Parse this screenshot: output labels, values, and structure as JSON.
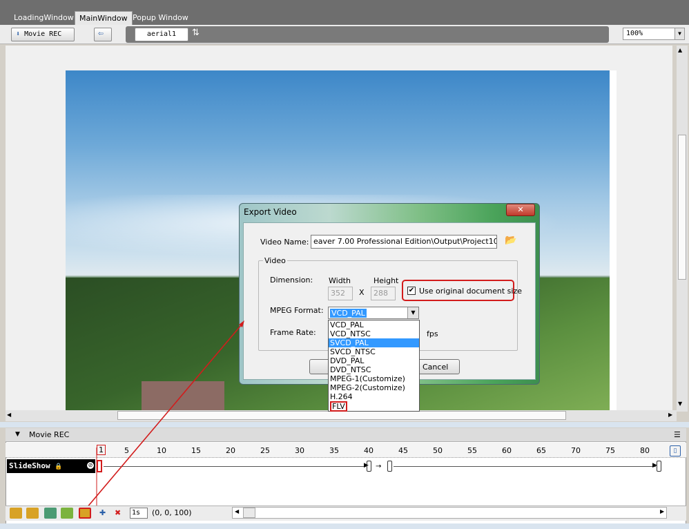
{
  "tabs": [
    {
      "label": "LoadingWindow",
      "active": false
    },
    {
      "label": "MainWindow",
      "active": true
    },
    {
      "label": "Popup Window",
      "active": false
    }
  ],
  "toolbar": {
    "movie_rec_label": "Movie REC",
    "layer_input": "aerial1",
    "zoom_value": "100%"
  },
  "dialog": {
    "title": "Export Video",
    "close_label": "✕",
    "video_name_label": "Video Name:",
    "video_name_value": "eaver 7.00 Professional Edition\\Output\\Project10.mpg",
    "group_label": "Video",
    "dimension_label": "Dimension:",
    "width_label": "Width",
    "height_label": "Height",
    "width_value": "352",
    "height_value": "288",
    "x_label": "X",
    "use_original_label": "Use original document size",
    "use_original_checked": true,
    "mpeg_format_label": "MPEG Format:",
    "mpeg_format_value": "VCD_PAL",
    "frame_rate_label": "Frame Rate:",
    "fps_label": "fps",
    "cancel_label": "Cancel",
    "format_options": [
      {
        "label": "VCD_PAL",
        "selected": false
      },
      {
        "label": "VCD_NTSC",
        "selected": false
      },
      {
        "label": "SVCD_PAL",
        "selected": true
      },
      {
        "label": "SVCD_NTSC",
        "selected": false
      },
      {
        "label": "DVD_PAL",
        "selected": false
      },
      {
        "label": "DVD_NTSC",
        "selected": false
      },
      {
        "label": "MPEG-1(Customize)",
        "selected": false
      },
      {
        "label": "MPEG-2(Customize)",
        "selected": false
      },
      {
        "label": "H.264",
        "selected": false
      },
      {
        "label": "FLV",
        "selected": false
      }
    ]
  },
  "timeline": {
    "panel_title": "Movie REC",
    "ruler_ticks": [
      "1",
      "5",
      "10",
      "15",
      "20",
      "25",
      "30",
      "35",
      "40",
      "45",
      "50",
      "55",
      "60",
      "65",
      "70",
      "75",
      "80"
    ],
    "layer_name": "SlideShow",
    "duration": "1s",
    "coords": "(0, 0, 100)"
  },
  "colors": {
    "highlight_red": "#d21c1c",
    "selection_blue": "#3399ff",
    "dialog_green": "#4aa35a"
  }
}
